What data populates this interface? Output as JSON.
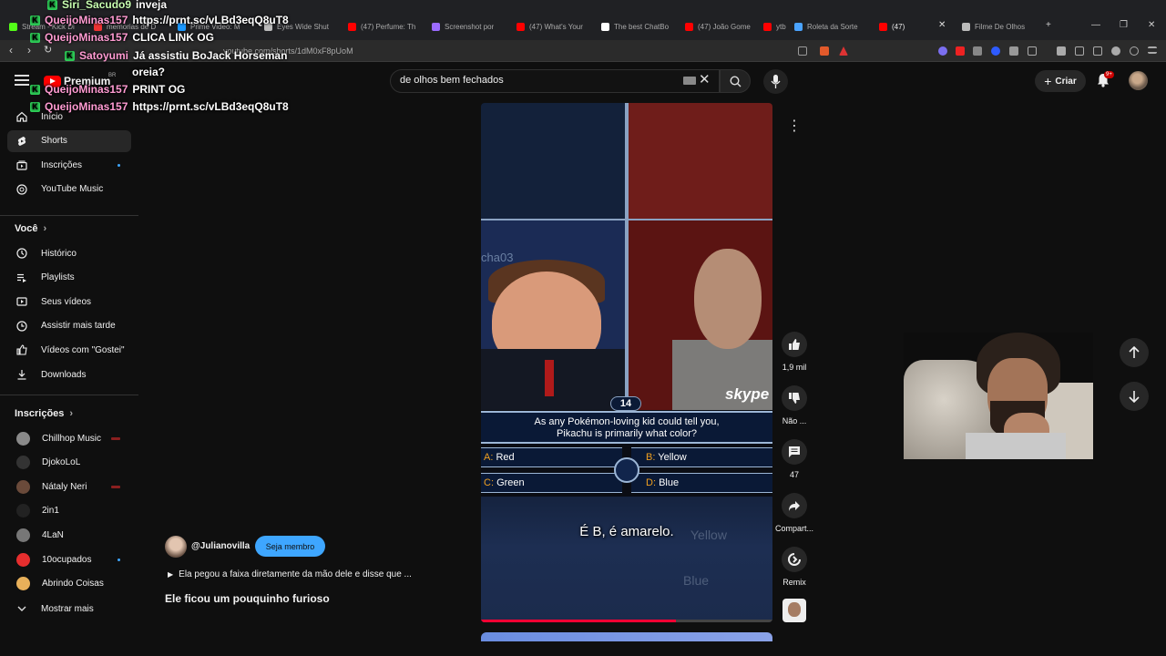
{
  "browser": {
    "tabs": [
      {
        "label": "Stream - Kick Di",
        "color": "#53fc18"
      },
      {
        "label": "memorias de D",
        "color": "#e33"
      },
      {
        "label": "Prime Video: M",
        "color": "#1a98ff"
      },
      {
        "label": "Eyes Wide Shut",
        "color": "#bbb"
      },
      {
        "label": "(47) Perfume: Th",
        "color": "#f00"
      },
      {
        "label": "Screenshot por",
        "color": "#9b6bff"
      },
      {
        "label": "(47) What's Your",
        "color": "#f00"
      },
      {
        "label": "The best ChatBo",
        "color": "#fff"
      },
      {
        "label": "(47) João Gome",
        "color": "#f00"
      },
      {
        "label": "ytb",
        "color": "#f00"
      },
      {
        "label": "Roleta da Sorte",
        "color": "#4aa3ff"
      },
      {
        "label": "(47) ",
        "color": "#f00"
      },
      {
        "label": "Filme De Olhos",
        "color": "#bbb"
      }
    ],
    "url": "youtube.com/shorts/1dM0xF8pUoM",
    "new_tab": "+",
    "minimize": "—",
    "restore": "❐",
    "close": "✕"
  },
  "chat": [
    {
      "user": "Siri_Sacudo9",
      "msg": "inveja",
      "user_color": "green"
    },
    {
      "user": "QueijoMinas157",
      "msg": "https://prnt.sc/vLBd3eqQ8uT8",
      "user_color": "pink"
    },
    {
      "user": "QueijoMinas157",
      "msg": "CLICA LINK OG",
      "user_color": "pink"
    },
    {
      "user": "Satoyumi",
      "msg": "Já assistiu BoJack Horseman",
      "user_color": "pink"
    },
    {
      "user": "",
      "msg": "oreia?",
      "user_color": "pink"
    },
    {
      "user": "QueijoMinas157",
      "msg": "PRINT OG",
      "user_color": "pink"
    },
    {
      "user": "QueijoMinas157",
      "msg": "https://prnt.sc/vLBd3eqQ8uT8",
      "user_color": "pink"
    }
  ],
  "header": {
    "logo": "Premium",
    "country": "BR",
    "search_query": "de olhos bem fechados",
    "create_label": "Criar",
    "notification_count": "9+"
  },
  "sidebar": {
    "main": [
      {
        "label": "Início",
        "icon": "home-icon"
      },
      {
        "label": "Shorts",
        "icon": "shorts-icon",
        "active": true
      },
      {
        "label": "Inscrições",
        "icon": "subscriptions-icon",
        "dot": true
      },
      {
        "label": "YouTube Music",
        "icon": "music-icon"
      }
    ],
    "you_heading": "Você",
    "you": [
      {
        "label": "Histórico",
        "icon": "history-icon"
      },
      {
        "label": "Playlists",
        "icon": "playlists-icon"
      },
      {
        "label": "Seus vídeos",
        "icon": "your-videos-icon"
      },
      {
        "label": "Assistir mais tarde",
        "icon": "watch-later-icon"
      },
      {
        "label": "Vídeos com \"Gostei\"",
        "icon": "liked-icon"
      },
      {
        "label": "Downloads",
        "icon": "download-icon"
      }
    ],
    "subs_heading": "Inscrições",
    "subs": [
      {
        "label": "Chillhop Music",
        "color": "#8a8a8a",
        "live": true
      },
      {
        "label": "DjokoLoL",
        "color": "#333",
        "live": false
      },
      {
        "label": "Nátaly Neri",
        "color": "#6a4a3a",
        "live": true
      },
      {
        "label": "2in1",
        "color": "#222",
        "live": false
      },
      {
        "label": "4LaN",
        "color": "#777",
        "live": false
      },
      {
        "label": "10ocupados",
        "color": "#e62e2e",
        "dot": true
      },
      {
        "label": "Abrindo Coisas",
        "color": "#e8b05a",
        "live": false
      }
    ],
    "show_more": "Mostrar mais"
  },
  "video": {
    "question_number": "14",
    "question_line1": "As any Pokémon-loving kid could tell you,",
    "question_line2": "Pikachu is primarily what color?",
    "answer_a_letter": "A:",
    "answer_a": "Red",
    "answer_b_letter": "B:",
    "answer_b": "Yellow",
    "answer_c_letter": "C:",
    "answer_c": "Green",
    "answer_d_letter": "D:",
    "answer_d": "Blue",
    "subtitle": "É B, é amarelo.",
    "skype_logo": "skype",
    "watermark": "cha03",
    "ghost_yellow": "Yellow",
    "ghost_blue": "Blue",
    "progress": 0.67
  },
  "actions": {
    "likes": "1,9 mil",
    "dislike": "Não ...",
    "comments": "47",
    "share": "Compart...",
    "remix": "Remix"
  },
  "channel": {
    "handle": "@Julianovilla",
    "join_label": "Seja membro",
    "description": "Ela pegou a faixa diretamente da mão dele e disse que ...",
    "title": "Ele ficou um pouquinho furioso"
  }
}
